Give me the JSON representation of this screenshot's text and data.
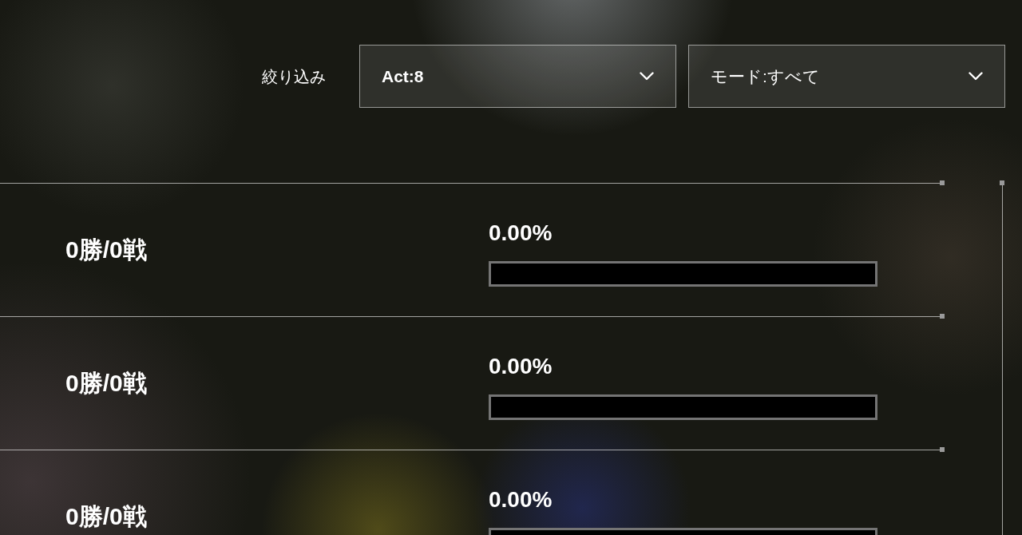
{
  "filter": {
    "label": "絞り込み",
    "dropdowns": [
      {
        "value": "Act:8"
      },
      {
        "value": "モード:すべて"
      }
    ]
  },
  "rows": [
    {
      "record": "0勝/0戦",
      "rate": "0.00%",
      "level": 0
    },
    {
      "record": "0勝/0戦",
      "rate": "0.00%",
      "level": 0
    },
    {
      "record": "0勝/0戦",
      "rate": "0.00%",
      "level": 0
    }
  ]
}
